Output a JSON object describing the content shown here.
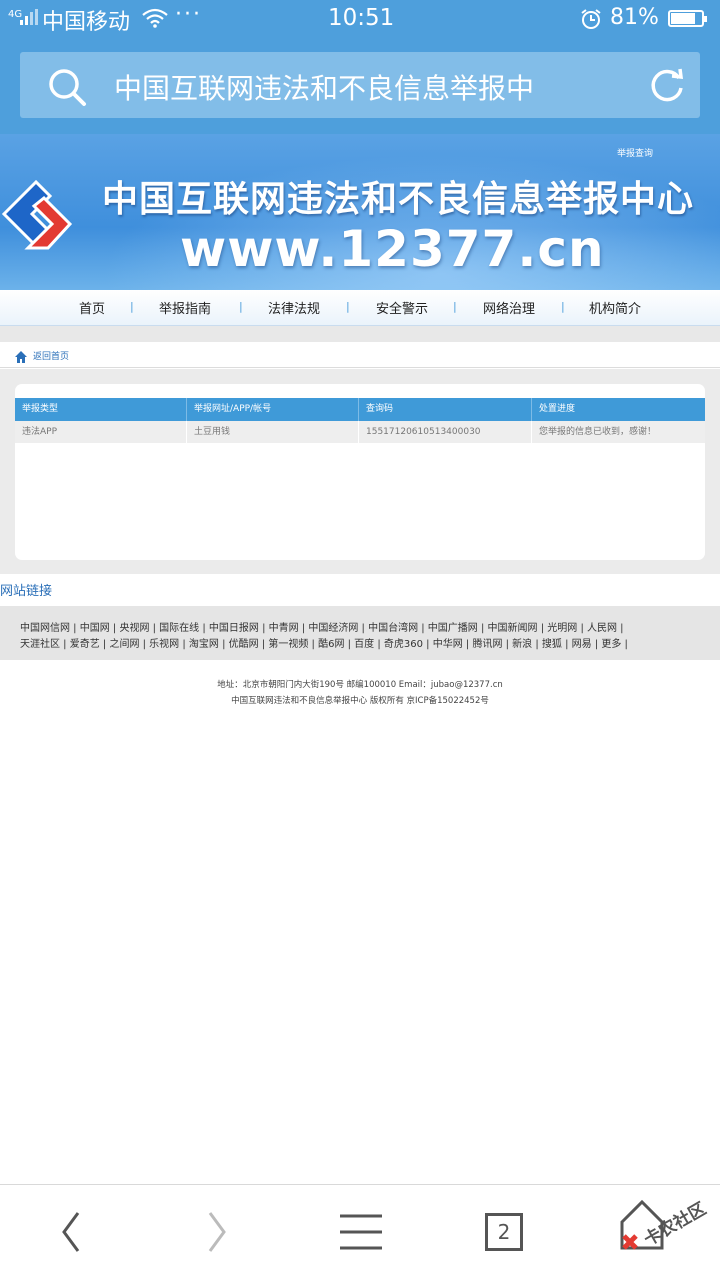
{
  "statusbar": {
    "network": "4G",
    "carrier": "中国移动",
    "time": "10:51",
    "battery_percent": "81%",
    "battery_level": 0.81
  },
  "address_bar": {
    "url_text": "中国互联网违法和不良信息举报中"
  },
  "banner": {
    "query_link": "举报查询",
    "title": "中国互联网违法和不良信息举报中心",
    "site": "www.12377.cn"
  },
  "nav": {
    "items": [
      "首页",
      "举报指南",
      "法律法规",
      "安全警示",
      "网络治理",
      "机构简介"
    ],
    "separator": "|"
  },
  "breadcrumb": {
    "label": "返回首页"
  },
  "report_table": {
    "headers": [
      "举报类型",
      "举报网址/APP/帐号",
      "查询码",
      "处置进度"
    ],
    "rows": [
      [
        "违法APP",
        "土豆用钱",
        "15517120610513400030",
        "您举报的信息已收到，感谢！"
      ]
    ]
  },
  "links": {
    "title": "网站链接",
    "line1": "中国网信网 | 中国网 | 央视网 | 国际在线 | 中国日报网 | 中青网 | 中国经济网 | 中国台湾网 | 中国广播网 | 中国新闻网 | 光明网 | 人民网 |",
    "line2": "天涯社区 | 爱奇艺 | 之间网 | 乐视网 | 淘宝网 | 优酷网 | 第一视频 | 酷6网 | 百度 | 奇虎360 | 中华网 | 腾讯网 | 新浪 | 搜狐 | 网易 | 更多 |"
  },
  "footer": {
    "address": "地址：北京市朝阳门内大街190号 邮编100010 Email：jubao@12377.cn",
    "copyright": "中国互联网违法和不良信息举报中心 版权所有 京ICP备15022452号"
  },
  "toolbar": {
    "tab_count": "2",
    "watermark": "卡农社区"
  },
  "colors": {
    "status_blue": "#4e9fdc",
    "table_header": "#3f9ad8",
    "link_blue": "#2a6fb8"
  },
  "icons": [
    "search-icon",
    "refresh-icon",
    "wifi-icon",
    "alarm-icon",
    "home-icon",
    "back-icon",
    "forward-icon",
    "menu-icon",
    "tabs-icon",
    "home-shortcut-icon"
  ]
}
